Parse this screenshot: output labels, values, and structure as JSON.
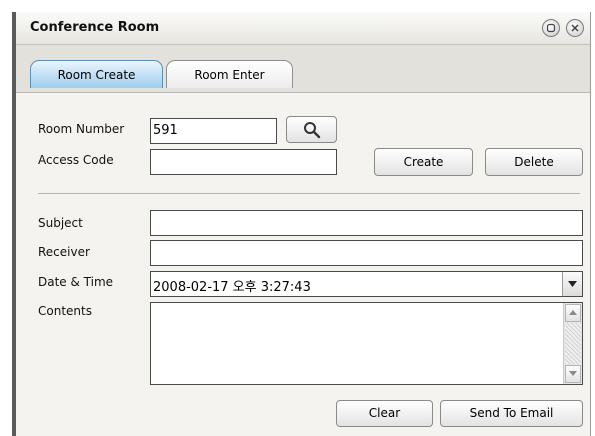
{
  "window": {
    "title": "Conference Room"
  },
  "tabs": [
    {
      "label": "Room Create",
      "active": true
    },
    {
      "label": "Room Enter",
      "active": false
    }
  ],
  "room": {
    "number_label": "Room Number",
    "number_value": "591",
    "access_label": "Access Code",
    "access_value": "",
    "create_label": "Create",
    "delete_label": "Delete"
  },
  "email": {
    "subject_label": "Subject",
    "subject_value": "",
    "receiver_label": "Receiver",
    "receiver_value": "",
    "datetime_label": "Date & Time",
    "datetime_value": "2008-02-17 오후 3:27:43",
    "contents_label": "Contents",
    "contents_value": ""
  },
  "actions": {
    "clear_label": "Clear",
    "send_label": "Send To Email"
  },
  "icons": {
    "restore": "restore-icon",
    "close": "close-icon",
    "search": "search-icon",
    "dropdown": "chevron-down-icon",
    "scroll_up": "scroll-up-icon",
    "scroll_down": "scroll-down-icon"
  },
  "colors": {
    "active_tab": "#9fcdee",
    "window_bg": "#f4f3ef"
  }
}
